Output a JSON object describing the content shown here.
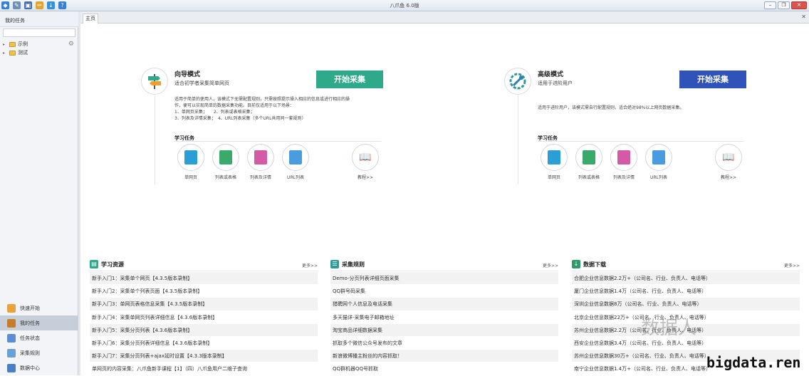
{
  "window": {
    "title": "八爪鱼 6.0版"
  },
  "sidebar": {
    "header": "我的任务",
    "tree": [
      {
        "label": "示例"
      },
      {
        "label": "测试"
      }
    ],
    "nav": [
      {
        "label": "快速开始",
        "color": "#e8a43a"
      },
      {
        "label": "我的任务",
        "color": "#c87b2c"
      },
      {
        "label": "任务状态",
        "color": "#5b8ed6"
      },
      {
        "label": "采集规则",
        "color": "#6aa0d8"
      },
      {
        "label": "数据中心",
        "color": "#4a7fc8"
      }
    ]
  },
  "tabs": [
    {
      "label": "主页"
    }
  ],
  "wizard": {
    "title": "向导模式",
    "subtitle": "适合初学者采集简单网页",
    "button": "开始采集",
    "button_color": "#2eaa8a",
    "desc": [
      "适用于简单的使用人，该模式下无需配置规则，只需按照提示操入相应的信息或进行相应的操",
      "作，便可以实现简单的数据采集功能。目前仅适用于以下场景：",
      "1、单网页采集；　　2、列表或表格采集；",
      "3、列表及详情采集；　4、URL列表采集（多个URL共用同一套规则）"
    ],
    "learn_title": "学习任务",
    "items": [
      {
        "label": "单网页",
        "color": "#2a9fd6"
      },
      {
        "label": "列表或表格",
        "color": "#3aaa6a"
      },
      {
        "label": "列表及详情",
        "color": "#d45aa5"
      },
      {
        "label": "URL列表",
        "color": "#4a9be0"
      },
      {
        "label": "教程>>",
        "color": "#ffffff"
      }
    ]
  },
  "advanced": {
    "title": "高级模式",
    "subtitle": "适用于进阶用户",
    "button": "开始采集",
    "button_color": "#2f53b8",
    "desc": [
      "适用于进阶用户，该模式需自行配置规则，适合绝对98%以上网页数据采集。"
    ],
    "learn_title": "学习任务",
    "items": [
      {
        "label": "单网页",
        "color": "#2a9fd6"
      },
      {
        "label": "列表或表格",
        "color": "#3aaa6a"
      },
      {
        "label": "列表及详情",
        "color": "#d45aa5"
      },
      {
        "label": "URL列表",
        "color": "#4a9be0"
      },
      {
        "label": "教程>>",
        "color": "#ffffff"
      }
    ]
  },
  "resources": {
    "title": "学习资源",
    "more": "更多>>",
    "color": "#2eaa8a",
    "rows": [
      "新手入门1：采集单个网页【4.3.5版本录制】",
      "新手入门2：采集单个列表页面【4.3.5版本录制】",
      "新手入门3：单网页表格信息采集【4.3.5版本录制】",
      "新手入门4：采集单网页列表详细信息【4.3.6版本录制】",
      "新手入门5：采集分页列表【4.3.6版本录制】",
      "新手入门6：采集分页列表详细信息【4.3.6版本录制】",
      "新手入门7：采集分页列表+ajax延时设置【4.3.3版本录制】",
      "单网页的内容采集：八爪鱼新手课程【1】（四）八爪鱼用户二维子查询"
    ]
  },
  "rules": {
    "title": "采集规则",
    "more": "更多>>",
    "color": "#2e9a9a",
    "rows": [
      "Demo-分页列表详细页面采集",
      "QQ群号码采集",
      "猎聘网个人信息及电话采集",
      "多天猫详-采集电子邮箱地址",
      "淘宝商品详细数据采集",
      "抓取多个微信公众号发布的文章",
      "新浪微博播主粉丝的内容抓取！",
      "QQ群机器QQ号抓取"
    ]
  },
  "downloads": {
    "title": "数据下载",
    "more": "更多>>",
    "color": "#2e9a6a",
    "rows": [
      "合肥企业信息数据2.2万+（公司名、行业、负责人、电话等）",
      "厦门企业信息数据1.4万（公司名、行业、负责人、电话等）",
      "深圳企业信息数据8万（公司名、行业、负责人、电话等）",
      "北京企业信息数据22万+（公司名、行业、负责人、电话等）",
      "苏州企业信息数据2.2万（公司名、行业、负责人、电话等）",
      "西安企业信息数据3.4万（公司名、行业、负责人、电话等）",
      "苏州企业信息数据30万+（公司名、行业、负责人、电话等）",
      "南宁企业信息数据1.4万+（公司名、行业、负责人、电话等）"
    ]
  },
  "watermark": {
    "text1": "数据人",
    "text2": "bigdata.ren"
  }
}
